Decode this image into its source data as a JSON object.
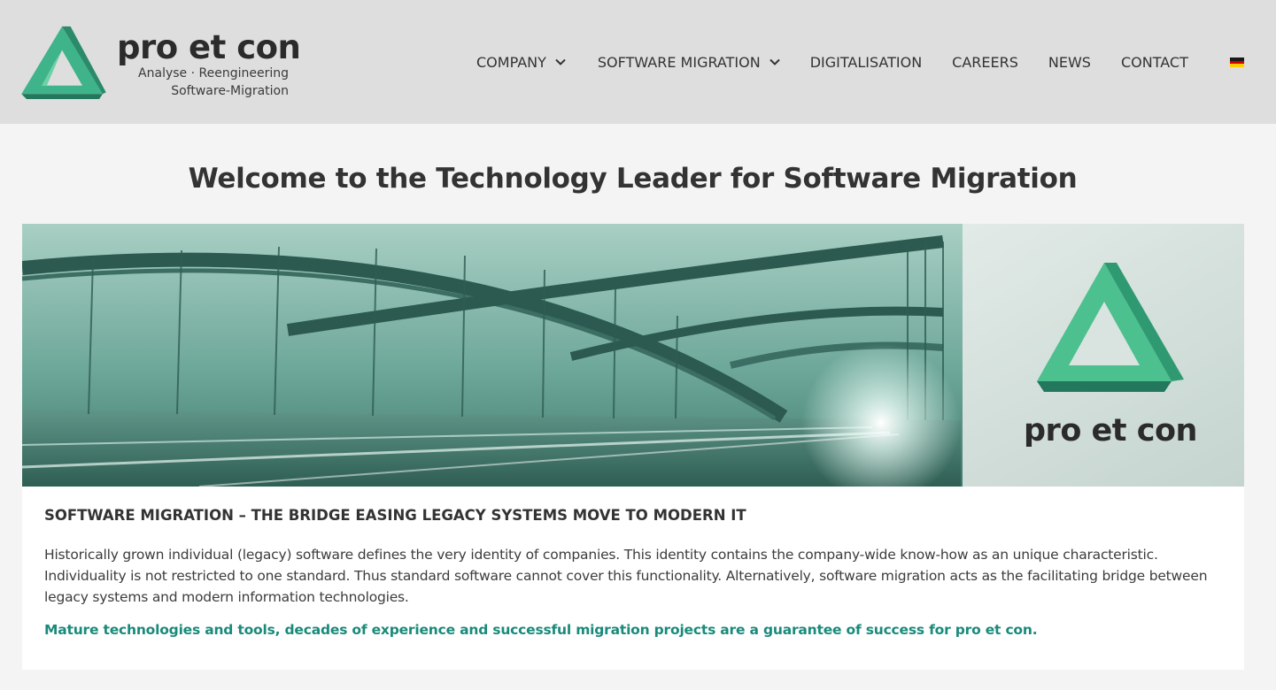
{
  "brand": {
    "name": "pro et con",
    "tagline_line1": "Analyse · Reengineering",
    "tagline_line2": "Software-Migration",
    "accent_color": "#1a8a7a"
  },
  "nav": {
    "items": [
      {
        "label": "COMPANY",
        "has_dropdown": true
      },
      {
        "label": "SOFTWARE MIGRATION",
        "has_dropdown": true
      },
      {
        "label": "DIGITALISATION",
        "has_dropdown": false
      },
      {
        "label": "CAREERS",
        "has_dropdown": false
      },
      {
        "label": "NEWS",
        "has_dropdown": false
      },
      {
        "label": "CONTACT",
        "has_dropdown": false
      }
    ],
    "language_icon": "german-flag-icon"
  },
  "main": {
    "title": "Welcome to the Technology Leader for Software Migration",
    "hero": {
      "logo_text": "pro et con"
    },
    "section_heading": "SOFTWARE MIGRATION – THE BRIDGE EASING LEGACY SYSTEMS MOVE TO MODERN IT",
    "body": "Historically grown individual (legacy) software defines the very identity of companies. This identity contains the company-wide know-how as an unique characteristic. Individuality is not restricted to one standard. Thus standard software cannot cover this functionality. Alternatively, software migration acts as the facilitating bridge between legacy systems and modern information technologies.",
    "highlight": "Mature technologies and tools, decades of experience and successful migration projects are a guarantee of success for pro et con."
  }
}
